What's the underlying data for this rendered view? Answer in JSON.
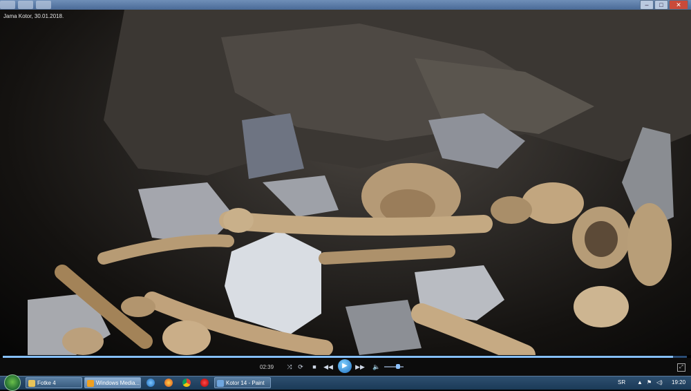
{
  "video": {
    "caption": "Jama Kotor, 30.01.2018."
  },
  "player": {
    "elapsed_time": "02:39",
    "seek_progress_percent": 98,
    "volume_percent": 70,
    "buttons": {
      "shuffle": "⤨",
      "repeat": "⟳",
      "stop": "■",
      "previous": "◀◀",
      "play": "▶",
      "next": "▶▶",
      "mute": "🔈",
      "fullscreen": "⤢"
    }
  },
  "taskbar": {
    "items": [
      {
        "label": "Fotke 4",
        "icon": "folder-icon",
        "active": false
      },
      {
        "label": "Windows Media...",
        "icon": "media-player-icon",
        "active": true
      },
      {
        "label": "Kotor 14 - Paint",
        "icon": "paint-icon",
        "active": false
      }
    ],
    "quick_launch": [
      "internet-explorer-icon",
      "firefox-icon",
      "chrome-icon",
      "opera-icon"
    ],
    "language": "SR",
    "clock": "19:20"
  },
  "colors": {
    "seek_fill": "#86c0ff",
    "taskbar": "#1b3a57",
    "play_button": "#1f6fc0"
  }
}
